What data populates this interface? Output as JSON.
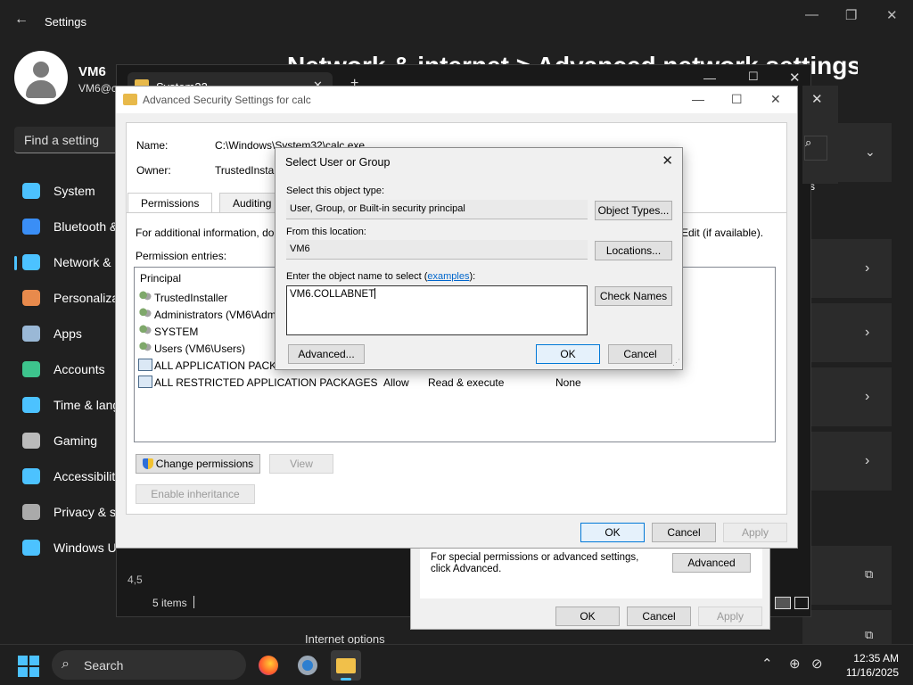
{
  "settings": {
    "title": "Settings",
    "user_name": "VM6",
    "user_email": "VM6@c",
    "search_placeholder": "Find a setting",
    "header": "Network & internet > Advanced network settings",
    "nav": [
      {
        "label": "System",
        "icon": "monitor-icon",
        "color": "#4cc2ff"
      },
      {
        "label": "Bluetooth & devices",
        "icon": "bluetooth-icon",
        "color": "#3a8ef6"
      },
      {
        "label": "Network & internet",
        "icon": "wifi-icon",
        "color": "#4cc2ff"
      },
      {
        "label": "Personalization",
        "icon": "brush-icon",
        "color": "#e88a4c"
      },
      {
        "label": "Apps",
        "icon": "apps-icon",
        "color": "#9ab8d6"
      },
      {
        "label": "Accounts",
        "icon": "person-icon",
        "color": "#3dc48d"
      },
      {
        "label": "Time & language",
        "icon": "globe-clock-icon",
        "color": "#4cc2ff"
      },
      {
        "label": "Gaming",
        "icon": "gamepad-icon",
        "color": "#bbbbbb"
      },
      {
        "label": "Accessibility",
        "icon": "accessibility-icon",
        "color": "#4cc2ff"
      },
      {
        "label": "Privacy & security",
        "icon": "shield-icon",
        "color": "#aaaaaa"
      },
      {
        "label": "Windows Update",
        "icon": "update-icon",
        "color": "#4cc2ff"
      }
    ],
    "details_label": "etails",
    "internet_options": "Internet options"
  },
  "explorer": {
    "tab_label": "System32",
    "status_items": "5 items",
    "status_left": "4,5"
  },
  "properties": {
    "special_text": "For special permissions or advanced settings, click Advanced.",
    "advanced_button": "Advanced",
    "ok": "OK",
    "cancel": "Cancel",
    "apply": "Apply"
  },
  "advanced_security": {
    "title": "Advanced Security Settings for calc",
    "name_label": "Name:",
    "name_value": "C:\\Windows\\System32\\calc.exe",
    "owner_label": "Owner:",
    "owner_value": "TrustedInstall",
    "tabs": [
      "Permissions",
      "Auditing"
    ],
    "info_text": "For additional information, do",
    "info_text_right": "Edit (if available).",
    "entries_label": "Permission entries:",
    "column_principal": "Principal",
    "entries": [
      {
        "principal": "TrustedInstaller",
        "type": "",
        "access": "",
        "inherited": "",
        "icon": "users-icon"
      },
      {
        "principal": "Administrators (VM6\\Adm",
        "type": "",
        "access": "",
        "inherited": "",
        "icon": "users-icon"
      },
      {
        "principal": "SYSTEM",
        "type": "",
        "access": "",
        "inherited": "",
        "icon": "users-icon"
      },
      {
        "principal": "Users (VM6\\Users)",
        "type": "",
        "access": "",
        "inherited": "",
        "icon": "users-icon"
      },
      {
        "principal": "ALL APPLICATION PACKA",
        "type": "",
        "access": "",
        "inherited": "",
        "icon": "package-icon"
      },
      {
        "principal": "ALL RESTRICTED APPLICATION PACKAGES",
        "type": "Allow",
        "access": "Read & execute",
        "inherited": "None",
        "icon": "package-icon"
      }
    ],
    "change_permissions": "Change permissions",
    "view": "View",
    "enable_inheritance": "Enable inheritance",
    "ok": "OK",
    "cancel": "Cancel",
    "apply": "Apply"
  },
  "select_user": {
    "title": "Select User or Group",
    "object_type_label": "Select this object type:",
    "object_type_value": "User, Group, or Built-in security principal",
    "object_types_button": "Object Types...",
    "location_label": "From this location:",
    "location_value": "VM6",
    "locations_button": "Locations...",
    "enter_label_pre": "Enter the object name to select (",
    "enter_label_link": "examples",
    "enter_label_post": "):",
    "object_name_value": "VM6.COLLABNET",
    "check_names_button": "Check Names",
    "advanced_button": "Advanced...",
    "ok": "OK",
    "cancel": "Cancel"
  },
  "taskbar": {
    "search_label": "Search",
    "time": "12:35 AM",
    "date": "11/16/2025"
  }
}
